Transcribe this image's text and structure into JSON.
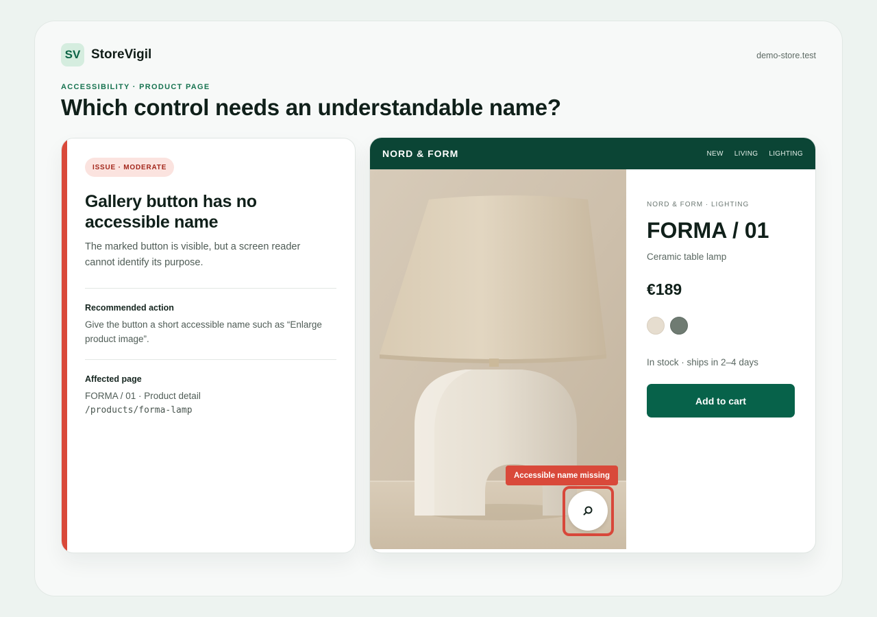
{
  "app": {
    "logo_text": "SV",
    "name": "StoreVigil",
    "domain": "demo-store.test"
  },
  "header": {
    "eyebrow": "ACCESSIBILITY · PRODUCT PAGE",
    "title": "Which control needs an understandable name?"
  },
  "issue": {
    "badge": "ISSUE · MODERATE",
    "title": "Gallery button has no accessible name",
    "description": "The marked button is visible, but a screen reader cannot identify its purpose.",
    "recommended_label": "Recommended action",
    "recommended_text": "Give the button a short accessible name such as “Enlarge product image”.",
    "affected_label": "Affected page",
    "affected_page": "FORMA / 01 · Product detail",
    "affected_path": "/products/forma-lamp"
  },
  "store": {
    "logo": "NORD & FORM",
    "nav": [
      "NEW",
      "LIVING",
      "LIGHTING"
    ],
    "product": {
      "breadcrumb": "NORD & FORM · LIGHTING",
      "name": "FORMA / 01",
      "subtitle": "Ceramic table lamp",
      "price": "€189",
      "swatches": [
        "#e6ddcf",
        "#6f7b72"
      ],
      "stock": "In stock · ships in 2–4 days",
      "add_to_cart": "Add to cart"
    },
    "gallery": {
      "tooltip": "Accessible name missing",
      "button_icon": "search-icon"
    }
  },
  "colors": {
    "accent": "#07624a",
    "nav": "#0b4535",
    "issue": "#d9493a"
  }
}
